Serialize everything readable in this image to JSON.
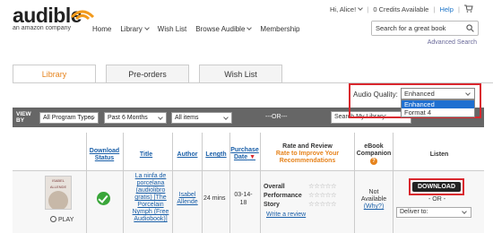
{
  "logo": {
    "word": "audible",
    "sub": "an amazon company"
  },
  "nav": {
    "home": "Home",
    "library": "Library",
    "wishlist": "Wish List",
    "browse": "Browse Audible",
    "membership": "Membership"
  },
  "user": {
    "greeting": "Hi, Alice!",
    "credits": "0 Credits Available",
    "help": "Help"
  },
  "search": {
    "placeholder": "Search for a great book",
    "advanced": "Advanced Search"
  },
  "tabs": [
    "Library",
    "Pre-orders",
    "Wish List"
  ],
  "audio_quality": {
    "label": "Audio Quality:",
    "selected": "Enhanced",
    "options": [
      "Enhanced",
      "Format 4"
    ]
  },
  "filters": {
    "view_by": [
      "VIEW",
      "BY"
    ],
    "program": "All Program Types",
    "period": "Past 6 Months",
    "items": "All items",
    "or": "---OR---",
    "lib_search": "Search My Library:"
  },
  "headers": {
    "download_status": [
      "Download",
      "Status"
    ],
    "title": "Title",
    "author": "Author",
    "length": "Length",
    "purchase_date": [
      "Purchase",
      "Date"
    ],
    "rate_review": "Rate and Review",
    "rate_sub": [
      "Rate to Improve Your",
      "Recommendations"
    ],
    "ebook": [
      "eBook",
      "Companion"
    ],
    "listen": "Listen"
  },
  "row": {
    "cover_text": [
      "ISABEL",
      "ALLENDE"
    ],
    "play": "PLAY",
    "title": "La ninfa de porcelana (audiolibro gratis) [The Porcelain Nymph (Free Audiobook)]",
    "author": "Isabel Allende",
    "length": "24 mins",
    "date": "03-14-18",
    "rating_labels": [
      "Overall",
      "Performance",
      "Story"
    ],
    "stars": "☆☆☆☆☆",
    "write_review": "Write a review",
    "ebook_status": [
      "Not",
      "Available"
    ],
    "ebook_why": "(Why?)",
    "download": "DOWNLOAD",
    "or": "- OR -",
    "deliver_to": "Deliver to:"
  },
  "colors": {
    "accent": "#e6831c",
    "highlight": "#d9272e",
    "link": "#1a5fa8"
  }
}
